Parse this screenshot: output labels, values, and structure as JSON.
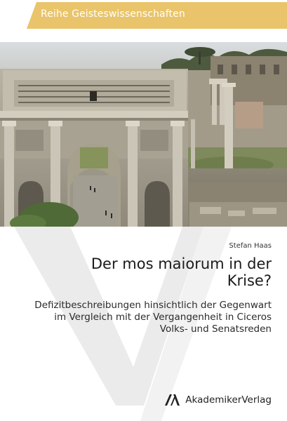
{
  "series": {
    "label": "Reihe Geisteswissenschaften"
  },
  "book": {
    "author": "Stefan Haas",
    "title": "Der mos maiorum in der Krise?",
    "subtitle": "Defizitbeschreibungen hinsichtlich der Gegenwart im Vergleich mit der Vergangenheit in Ciceros Volks- und Senatsreden"
  },
  "publisher": {
    "name": "AkademikerVerlag",
    "name_part1": "Akademiker",
    "name_part2": "Verlag"
  },
  "colors": {
    "accent": "#e9c46a",
    "watermark": "#e8e8e8",
    "text": "#1b1b1b"
  },
  "icons": {
    "publisher_logo": "av-logo-icon"
  }
}
